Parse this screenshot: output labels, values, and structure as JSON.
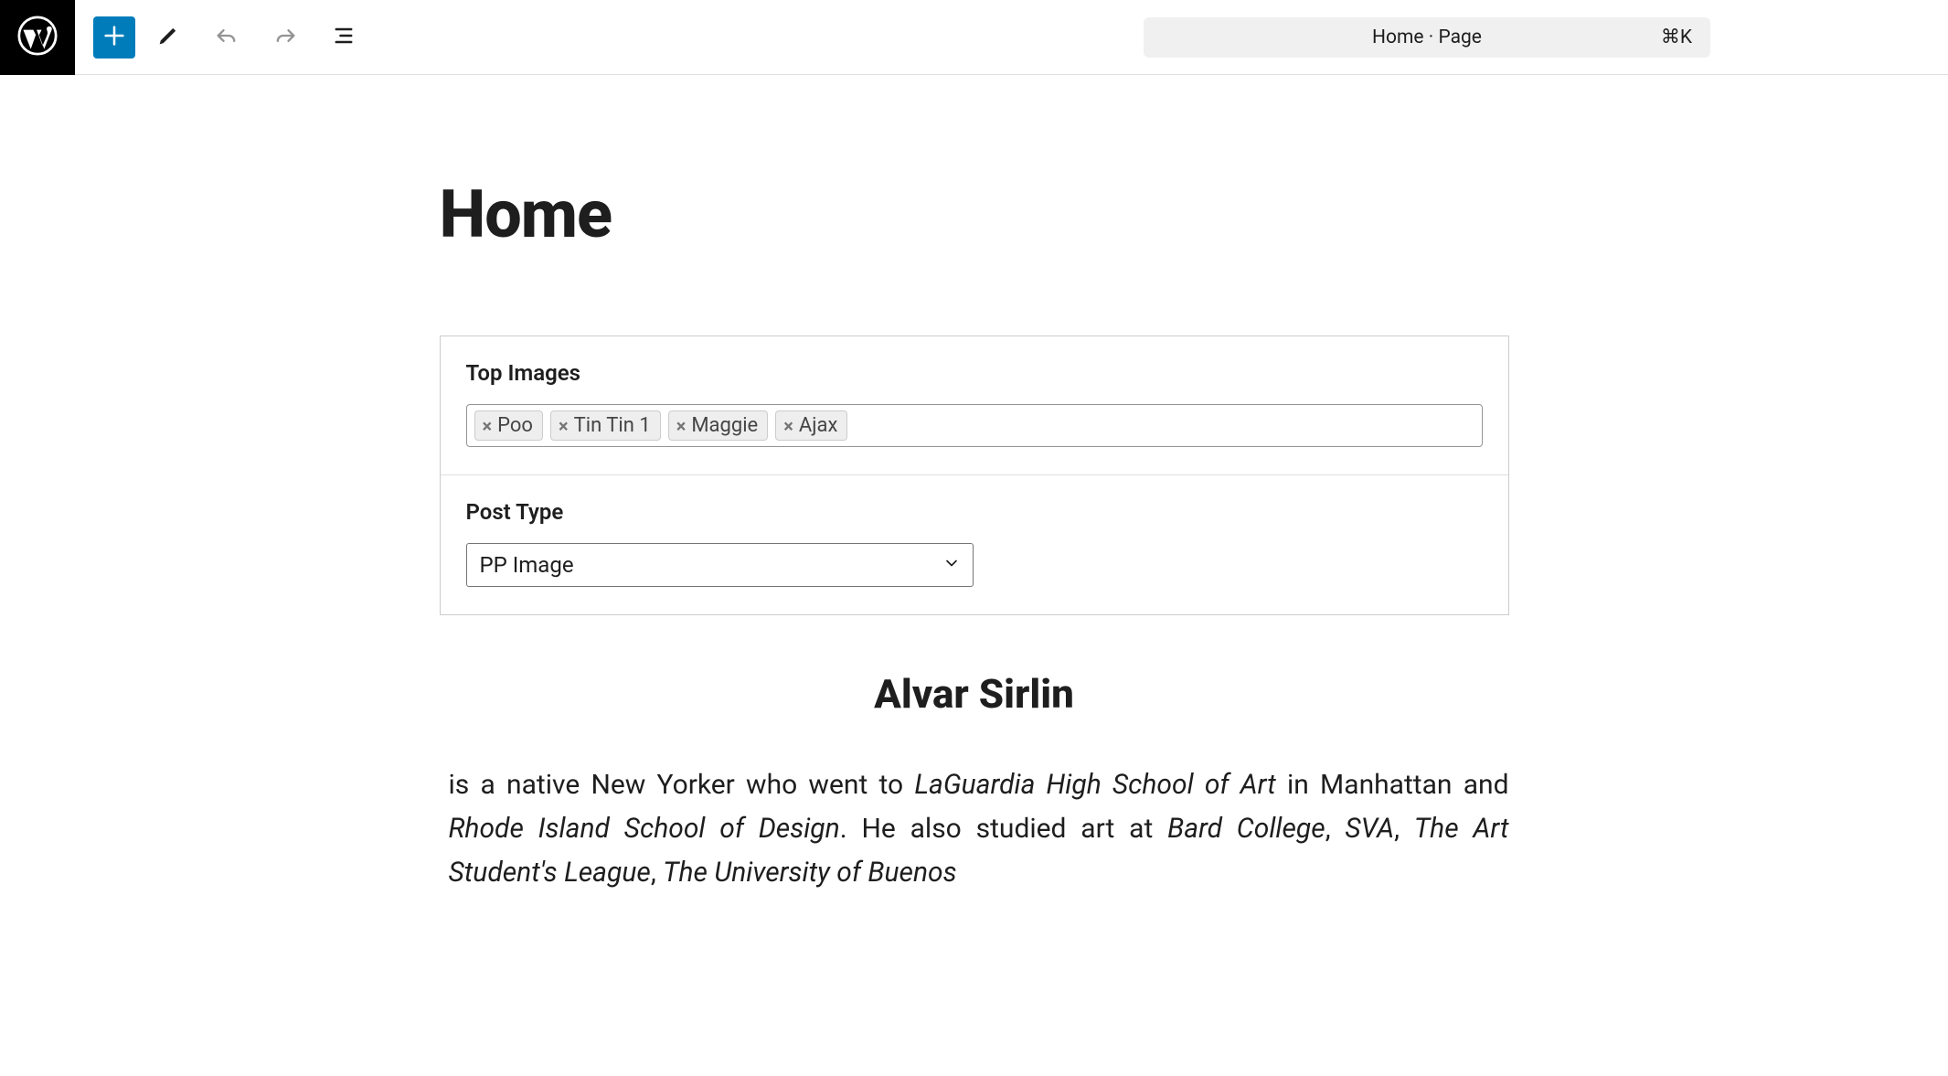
{
  "toolbar": {
    "command_label": "Home · Page",
    "shortcut": "⌘K"
  },
  "page": {
    "title": "Home"
  },
  "block": {
    "top_images": {
      "label": "Top Images",
      "tags": [
        "Poo",
        "Tin Tin 1",
        "Maggie",
        "Ajax"
      ]
    },
    "post_type": {
      "label": "Post Type",
      "value": "PP Image"
    }
  },
  "bio": {
    "heading": "Alvar Sirlin",
    "parts": [
      {
        "text": "is a native New Yorker who went to ",
        "italic": false
      },
      {
        "text": "LaGuardia High School of Art",
        "italic": true
      },
      {
        "text": " in Manhattan and ",
        "italic": false
      },
      {
        "text": "Rhode Island School of Design",
        "italic": true
      },
      {
        "text": ". He also studied art at ",
        "italic": false
      },
      {
        "text": "Bard College",
        "italic": true
      },
      {
        "text": ", ",
        "italic": false
      },
      {
        "text": "SVA",
        "italic": true
      },
      {
        "text": ", ",
        "italic": false
      },
      {
        "text": "The Art Student's League",
        "italic": true
      },
      {
        "text": ", ",
        "italic": false
      },
      {
        "text": "The University of Buenos",
        "italic": true
      }
    ]
  },
  "colors": {
    "accent": "#007cba",
    "toolbar_bg": "#000",
    "pill_bg": "#f0f0f0",
    "border": "#ccc"
  }
}
